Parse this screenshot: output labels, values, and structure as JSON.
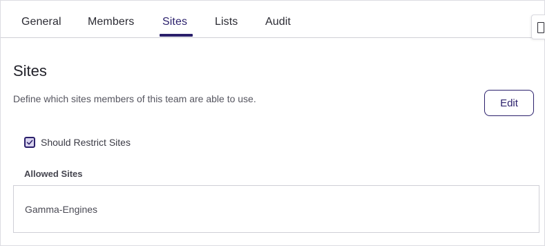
{
  "tabs": [
    {
      "label": "General",
      "active": false
    },
    {
      "label": "Members",
      "active": false
    },
    {
      "label": "Sites",
      "active": true
    },
    {
      "label": "Lists",
      "active": false
    },
    {
      "label": "Audit",
      "active": false
    }
  ],
  "side_panel_toggle": {
    "icon": "panel-toggle-icon"
  },
  "section": {
    "title": "Sites",
    "description": "Define which sites members of this team are able to use.",
    "edit_label": "Edit"
  },
  "restrict": {
    "label": "Should Restrict Sites",
    "checked": true
  },
  "allowed_sites": {
    "label": "Allowed Sites",
    "items": [
      "Gamma-Engines"
    ]
  },
  "colors": {
    "accent": "#2a1f6b",
    "checkbox_fill": "#d9d4ee",
    "border": "#cfcfd6"
  }
}
